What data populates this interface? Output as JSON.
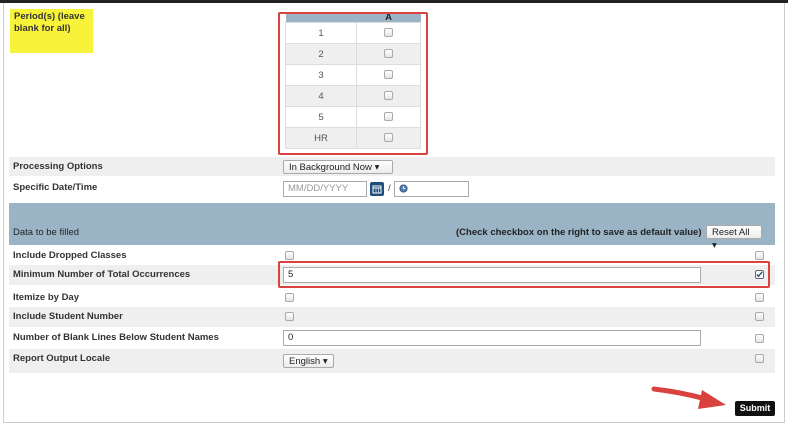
{
  "periods": {
    "label": "Period(s) (leave blank for all)",
    "column_header": "A",
    "rows": [
      "1",
      "2",
      "3",
      "4",
      "5",
      "HR"
    ]
  },
  "processing_options": {
    "label": "Processing Options",
    "value": "In Background Now"
  },
  "specific_datetime": {
    "label": "Specific Date/Time",
    "date_placeholder": "MM/DD/YYYY",
    "separator": "/"
  },
  "data_section": {
    "title": "Data to be filled",
    "hint": "(Check checkbox on the right to save as default value)",
    "reset_label": "Reset All"
  },
  "fields": {
    "include_dropped": {
      "label": "Include Dropped Classes"
    },
    "min_occurrences": {
      "label": "Minimum Number of Total Occurrences",
      "value": "5"
    },
    "itemize": {
      "label": "Itemize by Day"
    },
    "include_student_number": {
      "label": "Include Student Number"
    },
    "blank_lines": {
      "label": "Number of Blank Lines Below Student Names",
      "value": "0"
    },
    "locale": {
      "label": "Report Output Locale",
      "value": "English"
    }
  },
  "submit_label": "Submit",
  "colors": {
    "highlight": "#f7f33a",
    "header_blue": "#9ab4c6",
    "annotation_red": "#d9423f"
  }
}
